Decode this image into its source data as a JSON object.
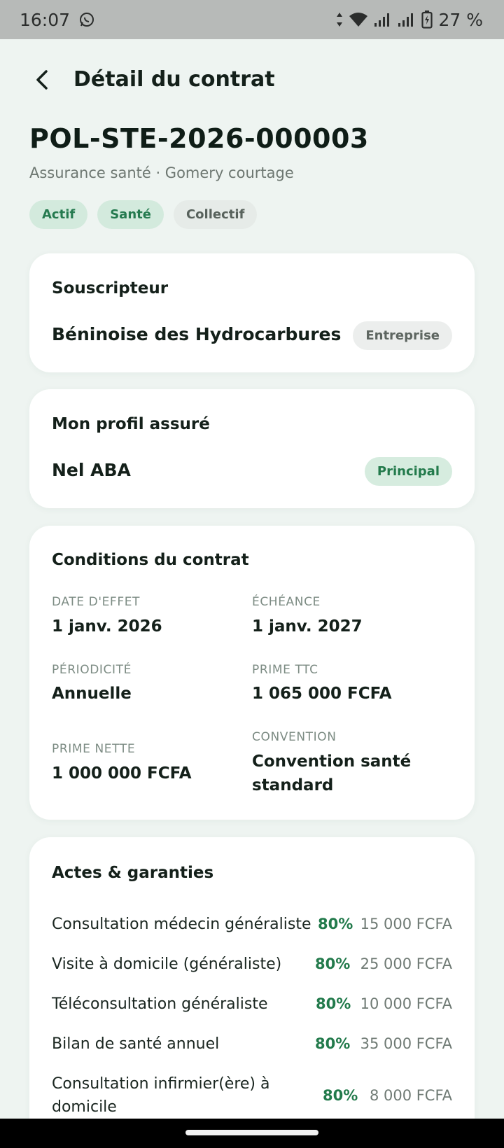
{
  "status_bar": {
    "time": "16:07",
    "battery": "27 %",
    "icons": [
      "whatsapp-icon",
      "data-arrows-icon",
      "wifi-icon",
      "signal-icon",
      "signal-icon",
      "battery-icon"
    ]
  },
  "header": {
    "title": "Détail du contrat",
    "back_icon": "back-arrow-icon"
  },
  "policy": {
    "number": "POL-STE-2026-000003",
    "subtitle": "Assurance santé · Gomery courtage",
    "tags": [
      "Actif",
      "Santé",
      "Collectif"
    ]
  },
  "souscripteur": {
    "title": "Souscripteur",
    "name": "Béninoise des Hydrocarbures",
    "badge": "Entreprise"
  },
  "profil": {
    "title": "Mon profil assuré",
    "name": "Nel ABA",
    "badge": "Principal"
  },
  "conditions": {
    "title": "Conditions du contrat",
    "date_effet_label": "DATE D'EFFET",
    "date_effet": "1 janv. 2026",
    "echeance_label": "ÉCHÉANCE",
    "echeance": "1 janv. 2027",
    "periodicite_label": "PÉRIODICITÉ",
    "periodicite": "Annuelle",
    "prime_ttc_label": "PRIME TTC",
    "prime_ttc": "1 065 000 FCFA",
    "prime_nette_label": "PRIME NETTE",
    "prime_nette": "1 000 000 FCFA",
    "convention_label": "CONVENTION",
    "convention": "Convention santé standard"
  },
  "actes": {
    "title": "Actes & garanties",
    "items": [
      {
        "name": "Consultation médecin généraliste",
        "pct": "80%",
        "amount": "15 000 FCFA"
      },
      {
        "name": "Visite à domicile (généraliste)",
        "pct": "80%",
        "amount": "25 000 FCFA"
      },
      {
        "name": "Téléconsultation généraliste",
        "pct": "80%",
        "amount": "10 000 FCFA"
      },
      {
        "name": "Bilan de santé annuel",
        "pct": "80%",
        "amount": "35 000 FCFA"
      },
      {
        "name": "Consultation infirmier(ère) à domicile",
        "pct": "80%",
        "amount": "8 000 FCFA"
      }
    ]
  },
  "colors": {
    "accent": "#227a4b",
    "background": "#eef4f1",
    "card": "#ffffff"
  }
}
